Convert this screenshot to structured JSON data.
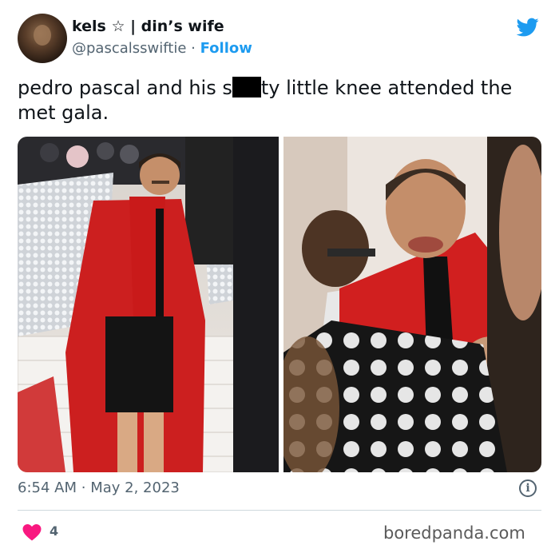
{
  "author": {
    "display_name": "kels ☆ | din’s wife",
    "handle": "@pascalsswiftie",
    "separator": "·",
    "follow_label": "Follow",
    "avatar_icon": "profile-photo"
  },
  "tweet": {
    "text_before": "pedro pascal and his s",
    "text_after": "ty little knee attended the met gala."
  },
  "media": [
    {
      "icon": "photo-red-coat-stairs"
    },
    {
      "icon": "photo-red-coat-smiling"
    }
  ],
  "meta": {
    "time": "6:54 AM",
    "separator": "·",
    "date": "May 2, 2023",
    "info_icon": "i"
  },
  "engagement": {
    "likes": "4",
    "heart_icon": "heart-icon"
  },
  "watermark": "boredpanda.com",
  "colors": {
    "accent": "#1d9bf0",
    "heart": "#f91880",
    "muted": "#536471",
    "text": "#0f1419"
  }
}
